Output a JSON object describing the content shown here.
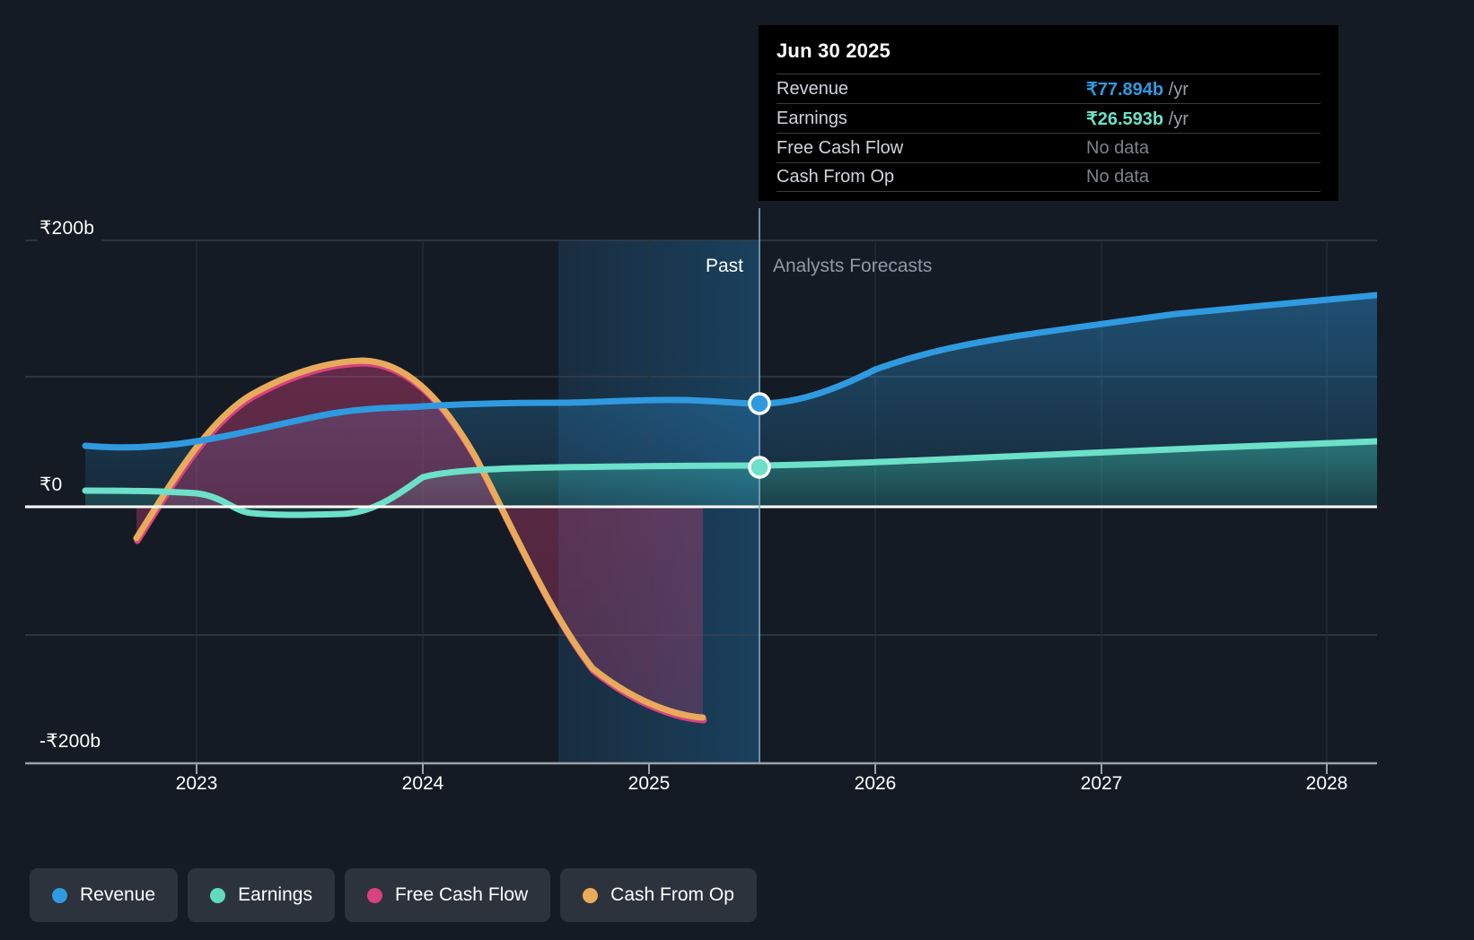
{
  "tooltip": {
    "date": "Jun 30 2025",
    "rows": [
      {
        "label": "Revenue",
        "value": "₹77.894b",
        "unit": " /yr",
        "color": "#2f9ae0",
        "no_data": false
      },
      {
        "label": "Earnings",
        "value": "₹26.593b",
        "unit": " /yr",
        "color": "#6ce0c8",
        "no_data": false
      },
      {
        "label": "Free Cash Flow",
        "value": "No data",
        "unit": "",
        "color": "#7d848c",
        "no_data": true
      },
      {
        "label": "Cash From Op",
        "value": "No data",
        "unit": "",
        "color": "#7d848c",
        "no_data": true
      }
    ]
  },
  "bands": {
    "past_label": "Past",
    "forecast_label": "Analysts Forecasts"
  },
  "legend": {
    "items": [
      {
        "label": "Revenue",
        "color": "#2f9ae0"
      },
      {
        "label": "Earnings",
        "color": "#5fdcc0"
      },
      {
        "label": "Free Cash Flow",
        "color": "#d9417f"
      },
      {
        "label": "Cash From Op",
        "color": "#e8ab5c"
      }
    ]
  },
  "chart_data": {
    "type": "line",
    "title": "",
    "xlabel": "",
    "ylabel": "",
    "currency_symbol": "₹",
    "units": "b",
    "ylim": [
      -200,
      200
    ],
    "y_ticks": [
      200,
      0,
      -200
    ],
    "y_tick_labels": [
      "₹200b",
      "₹0",
      "-₹200b"
    ],
    "x_ticks": [
      2023,
      2024,
      2025,
      2026,
      2027,
      2028
    ],
    "x_tick_labels": [
      "2023",
      "2024",
      "2025",
      "2026",
      "2027",
      "2028"
    ],
    "grid": true,
    "legend_position": "bottom-left",
    "zero_line": 0,
    "past_forecast_split_x": 2025.5,
    "highlight_band": [
      2024.5,
      2025.5
    ],
    "markers": [
      {
        "series": "Revenue",
        "x": 2025.5,
        "y": 77.894,
        "color": "#2f9ae0"
      },
      {
        "series": "Earnings",
        "x": 2025.5,
        "y": 26.593,
        "color": "#6ce0c8"
      }
    ],
    "series": [
      {
        "name": "Revenue",
        "color": "#2f9ae0",
        "fill": true,
        "x": [
          2022.35,
          2022.7,
          2023.0,
          2023.3,
          2023.6,
          2023.9,
          2024.2,
          2024.5,
          2024.8,
          2025.1,
          2025.5,
          2025.8,
          2026.1,
          2026.5,
          2027.0,
          2027.5,
          2028.0,
          2028.45
        ],
        "values": [
          46,
          45,
          47,
          57,
          62,
          66,
          72,
          75,
          75,
          74,
          77.894,
          82,
          98,
          106,
          113,
          121,
          130,
          140
        ]
      },
      {
        "name": "Earnings",
        "color": "#6ce0c8",
        "fill": true,
        "x": [
          2022.35,
          2022.7,
          2023.0,
          2023.3,
          2023.6,
          2023.9,
          2024.2,
          2024.5,
          2024.8,
          2025.1,
          2025.5,
          2025.8,
          2026.1,
          2026.5,
          2027.0,
          2027.5,
          2028.0,
          2028.45
        ],
        "values": [
          7,
          7,
          -5,
          -7,
          -6,
          -5,
          14,
          22,
          23,
          24,
          26.593,
          28,
          30,
          32,
          35,
          38,
          41,
          44
        ]
      },
      {
        "name": "Free Cash Flow",
        "color": "#d9417f",
        "fill": true,
        "x": [
          2022.6,
          2022.9,
          2023.2,
          2023.5,
          2023.8,
          2024.0,
          2024.3,
          2024.6,
          2024.9,
          2025.15
        ],
        "values": [
          -25,
          45,
          110,
          132,
          120,
          65,
          -20,
          -105,
          -150,
          -163
        ]
      },
      {
        "name": "Cash From Op",
        "color": "#e8ab5c",
        "fill": false,
        "x": [
          2022.6,
          2022.9,
          2023.2,
          2023.5,
          2023.8,
          2024.0,
          2024.3,
          2024.6,
          2024.9,
          2025.15
        ],
        "values": [
          -24,
          46,
          111,
          133,
          121,
          66,
          -19,
          -104,
          -149,
          -162
        ]
      }
    ]
  }
}
